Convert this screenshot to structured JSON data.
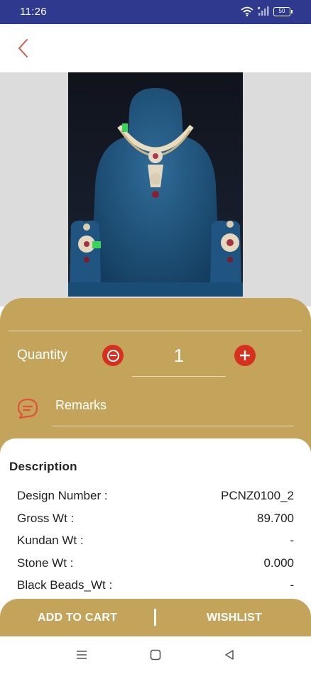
{
  "status_bar": {
    "time": "11:26",
    "battery": "50",
    "icons": [
      "wifi-icon",
      "signal-icon",
      "battery-icon"
    ]
  },
  "header": {
    "back_icon": "chevron-left-icon",
    "accent_color": "#d9564a"
  },
  "product": {
    "image": "necklace-earrings-on-blue-velvet-bust"
  },
  "quantity": {
    "label": "Quantity",
    "value": "1",
    "decrement_icon": "minus-circle-icon",
    "increment_icon": "plus-circle-icon"
  },
  "remarks": {
    "placeholder": "Remarks",
    "icon": "chat-bubble-icon"
  },
  "description": {
    "title": "Description",
    "rows": [
      {
        "label": "Design Number :",
        "value": "PCNZ0100_2"
      },
      {
        "label": "Gross Wt :",
        "value": "89.700"
      },
      {
        "label": "Kundan Wt :",
        "value": "-"
      },
      {
        "label": "Stone Wt :",
        "value": "0.000"
      },
      {
        "label": "Black Beads_Wt :",
        "value": "-"
      }
    ]
  },
  "actions": {
    "add_to_cart": "ADD TO CART",
    "wishlist": "WISHLIST"
  },
  "nav_bar": {
    "icons": [
      "menu-icon",
      "home-icon",
      "back-triangle-icon"
    ]
  },
  "colors": {
    "status_bar": "#2f3a8f",
    "gold": "#c4a45b",
    "button_red": "#d6301f"
  }
}
